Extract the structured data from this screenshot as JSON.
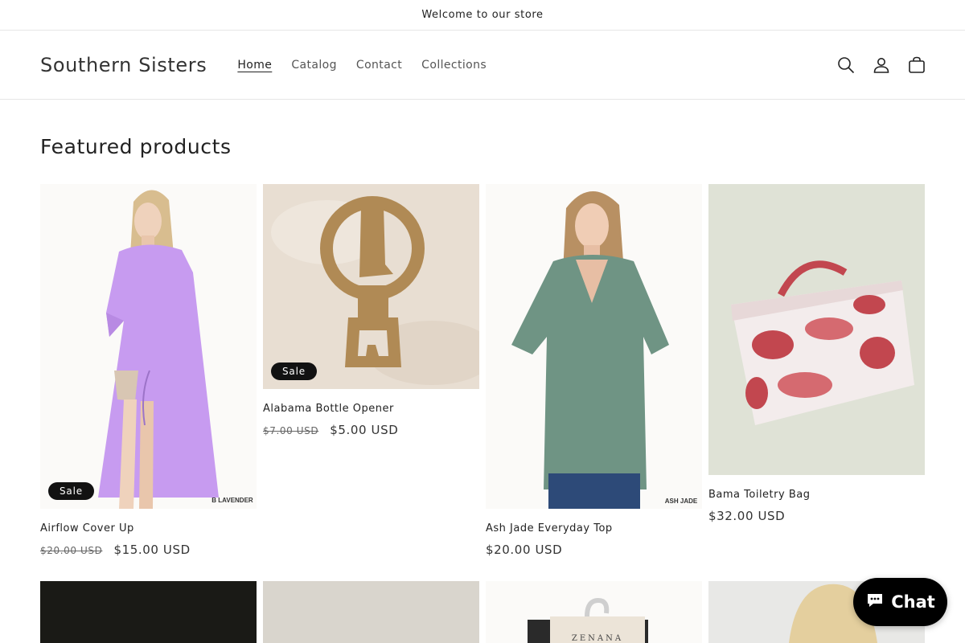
{
  "announcement": {
    "text": "Welcome to our store"
  },
  "header": {
    "logo": "Southern Sisters",
    "nav": [
      "Home",
      "Catalog",
      "Contact",
      "Collections"
    ],
    "icons": [
      "search-icon",
      "account-icon",
      "cart-icon"
    ]
  },
  "featured": {
    "title": "Featured products",
    "products": [
      {
        "name": "Airflow Cover Up",
        "old_price": "$20.00 USD",
        "price": "$15.00 USD",
        "badge": "Sale",
        "image_label": "B LAVENDER"
      },
      {
        "name": "Alabama Bottle Opener",
        "old_price": "$7.00 USD",
        "price": "$5.00 USD",
        "badge": "Sale"
      },
      {
        "name": "Ash Jade Everyday Top",
        "price": "$20.00 USD",
        "image_label": "ASH JADE"
      },
      {
        "name": "Bama Toiletry Bag",
        "price": "$32.00 USD"
      }
    ],
    "row2_label": "ZENANA"
  },
  "chat": {
    "label": "Chat"
  },
  "colors": {
    "lavender": "#c79bf0",
    "jade": "#6f9484",
    "sale_badge": "#121212",
    "toile_red": "#c2474f"
  }
}
